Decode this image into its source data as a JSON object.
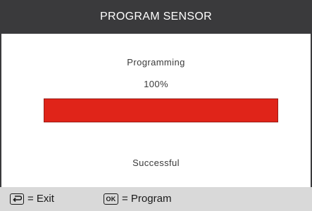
{
  "header": {
    "title": "PROGRAM SENSOR"
  },
  "status": {
    "label": "Programming",
    "percent_text": "100%",
    "progress_fraction": 1.0,
    "result": "Successful"
  },
  "footer": {
    "exit_key_icon": "back-return-icon",
    "exit_label": "= Exit",
    "ok_key_text": "OK",
    "program_label": "= Program"
  },
  "colors": {
    "header_bg": "#3a3a3c",
    "progress_fill": "#e02419",
    "footer_bg": "#d9d9d9"
  }
}
